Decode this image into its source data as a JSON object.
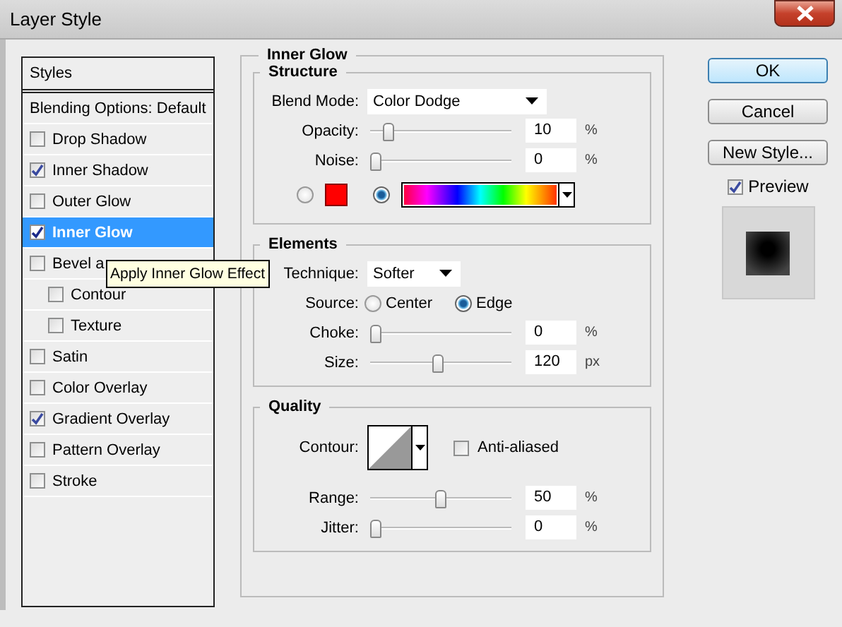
{
  "window": {
    "title": "Layer Style"
  },
  "styles_panel": {
    "header": "Styles",
    "items": [
      {
        "label": "Blending Options: Default",
        "kind": "plain",
        "selected": false
      },
      {
        "label": "Drop Shadow",
        "kind": "effect",
        "checked": false,
        "selected": false
      },
      {
        "label": "Inner Shadow",
        "kind": "effect",
        "checked": true,
        "selected": false
      },
      {
        "label": "Outer Glow",
        "kind": "effect",
        "checked": false,
        "selected": false
      },
      {
        "label": "Inner Glow",
        "kind": "effect",
        "checked": true,
        "selected": true
      },
      {
        "label": "Bevel a",
        "kind": "effect",
        "checked": false,
        "selected": false,
        "children": [
          {
            "label": "Contour",
            "kind": "effect",
            "checked": false,
            "selected": false
          },
          {
            "label": "Texture",
            "kind": "effect",
            "checked": false,
            "selected": false
          }
        ]
      },
      {
        "label": "Satin",
        "kind": "effect",
        "checked": false,
        "selected": false
      },
      {
        "label": "Color Overlay",
        "kind": "effect",
        "checked": false,
        "selected": false
      },
      {
        "label": "Gradient Overlay",
        "kind": "effect",
        "checked": true,
        "selected": false
      },
      {
        "label": "Pattern Overlay",
        "kind": "effect",
        "checked": false,
        "selected": false
      },
      {
        "label": "Stroke",
        "kind": "effect",
        "checked": false,
        "selected": false
      }
    ]
  },
  "tooltip": "Apply Inner Glow Effect",
  "inner_glow": {
    "title": "Inner Glow",
    "sections": [
      {
        "title": "Structure",
        "rows": [
          {
            "kind": "dropdown",
            "label": "Blend Mode:",
            "value": "Color Dodge"
          },
          {
            "kind": "slider",
            "label": "Opacity:",
            "level": 0.1,
            "value": "10",
            "unit": "%"
          },
          {
            "kind": "slider",
            "label": "Noise:",
            "level": 0,
            "value": "0",
            "unit": "%"
          },
          {
            "kind": "fill",
            "options": [
              {
                "kind": "color",
                "selected": false,
                "color": "#ff0000"
              },
              {
                "kind": "gradient",
                "selected": true
              }
            ]
          }
        ]
      },
      {
        "title": "Elements",
        "rows": [
          {
            "kind": "dropdown",
            "label": "Technique:",
            "value": "Softer"
          },
          {
            "kind": "radio",
            "label": "Source:",
            "options": [
              {
                "label": "Center",
                "selected": false
              },
              {
                "label": "Edge",
                "selected": true
              }
            ]
          },
          {
            "kind": "slider",
            "label": "Choke:",
            "level": 0,
            "value": "0",
            "unit": "%"
          },
          {
            "kind": "slider",
            "label": "Size:",
            "level": 0.48,
            "value": "120",
            "unit": "px"
          }
        ]
      },
      {
        "title": "Quality",
        "rows": [
          {
            "kind": "contour",
            "label": "Contour:",
            "checkbox": {
              "label": "Anti-aliased",
              "checked": false
            }
          },
          {
            "kind": "slider",
            "label": "Range:",
            "level": 0.5,
            "value": "50",
            "unit": "%"
          },
          {
            "kind": "slider",
            "label": "Jitter:",
            "level": 0,
            "value": "0",
            "unit": "%"
          }
        ]
      }
    ]
  },
  "buttons": [
    {
      "label": "OK",
      "default": true
    },
    {
      "label": "Cancel",
      "default": false
    },
    {
      "label": "New Style...",
      "default": false
    }
  ],
  "preview": {
    "label": "Preview",
    "checked": true
  }
}
